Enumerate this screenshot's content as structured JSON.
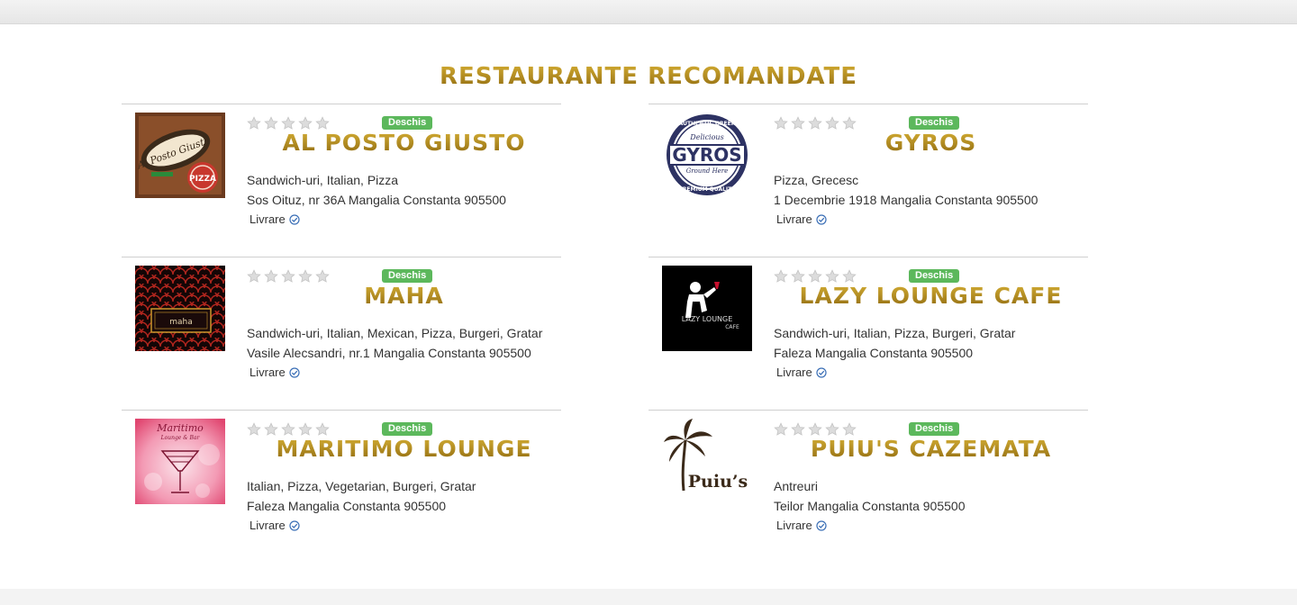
{
  "section_title": "Restaurante recomandate",
  "colors": {
    "title_gold": "#b8921e",
    "open_badge": "#5cb85c",
    "check_blue": "#3b6fb6"
  },
  "restaurants": [
    {
      "name": "Al Posto Giusto",
      "status": "Deschis",
      "rating": 0,
      "cuisine": "Sandwich-uri, Italian, Pizza",
      "address": "Sos Oituz, nr 36A Mangalia Constanta 905500",
      "delivery": "Livrare",
      "logo_icon": "pizza-logo-icon",
      "logo_text": "Al Posto Giusto"
    },
    {
      "name": "Gyros",
      "status": "Deschis",
      "rating": 0,
      "cuisine": "Pizza, Grecesc",
      "address": "1 Decembrie 1918 Mangalia Constanta 905500",
      "delivery": "Livrare",
      "logo_icon": "gyros-seal-icon",
      "logo_text": "GYROS"
    },
    {
      "name": "Maha",
      "status": "Deschis",
      "rating": 0,
      "cuisine": "Sandwich-uri, Italian, Mexican, Pizza, Burgeri, Gratar",
      "address": "Vasile Alecsandri, nr.1 Mangalia Constanta 905500",
      "delivery": "Livrare",
      "logo_icon": "maha-logo-icon",
      "logo_text": "maha"
    },
    {
      "name": "Lazy Lounge Cafe",
      "status": "Deschis",
      "rating": 0,
      "cuisine": "Sandwich-uri, Italian, Pizza, Burgeri, Gratar",
      "address": "Faleza Mangalia Constanta 905500",
      "delivery": "Livrare",
      "logo_icon": "waiter-logo-icon",
      "logo_text": "LAZY LOUNGE CAFE"
    },
    {
      "name": "Maritimo Lounge",
      "status": "Deschis",
      "rating": 0,
      "cuisine": "Italian, Pizza, Vegetarian, Burgeri, Gratar",
      "address": "Faleza Mangalia Constanta 905500",
      "delivery": "Livrare",
      "logo_icon": "cocktail-logo-icon",
      "logo_text": "Maritimo"
    },
    {
      "name": "Puiu's Cazemata",
      "status": "Deschis",
      "rating": 0,
      "cuisine": "Antreuri",
      "address": "Teilor Mangalia Constanta 905500",
      "delivery": "Livrare",
      "logo_icon": "palm-tree-logo-icon",
      "logo_text": "Puiu's"
    }
  ]
}
